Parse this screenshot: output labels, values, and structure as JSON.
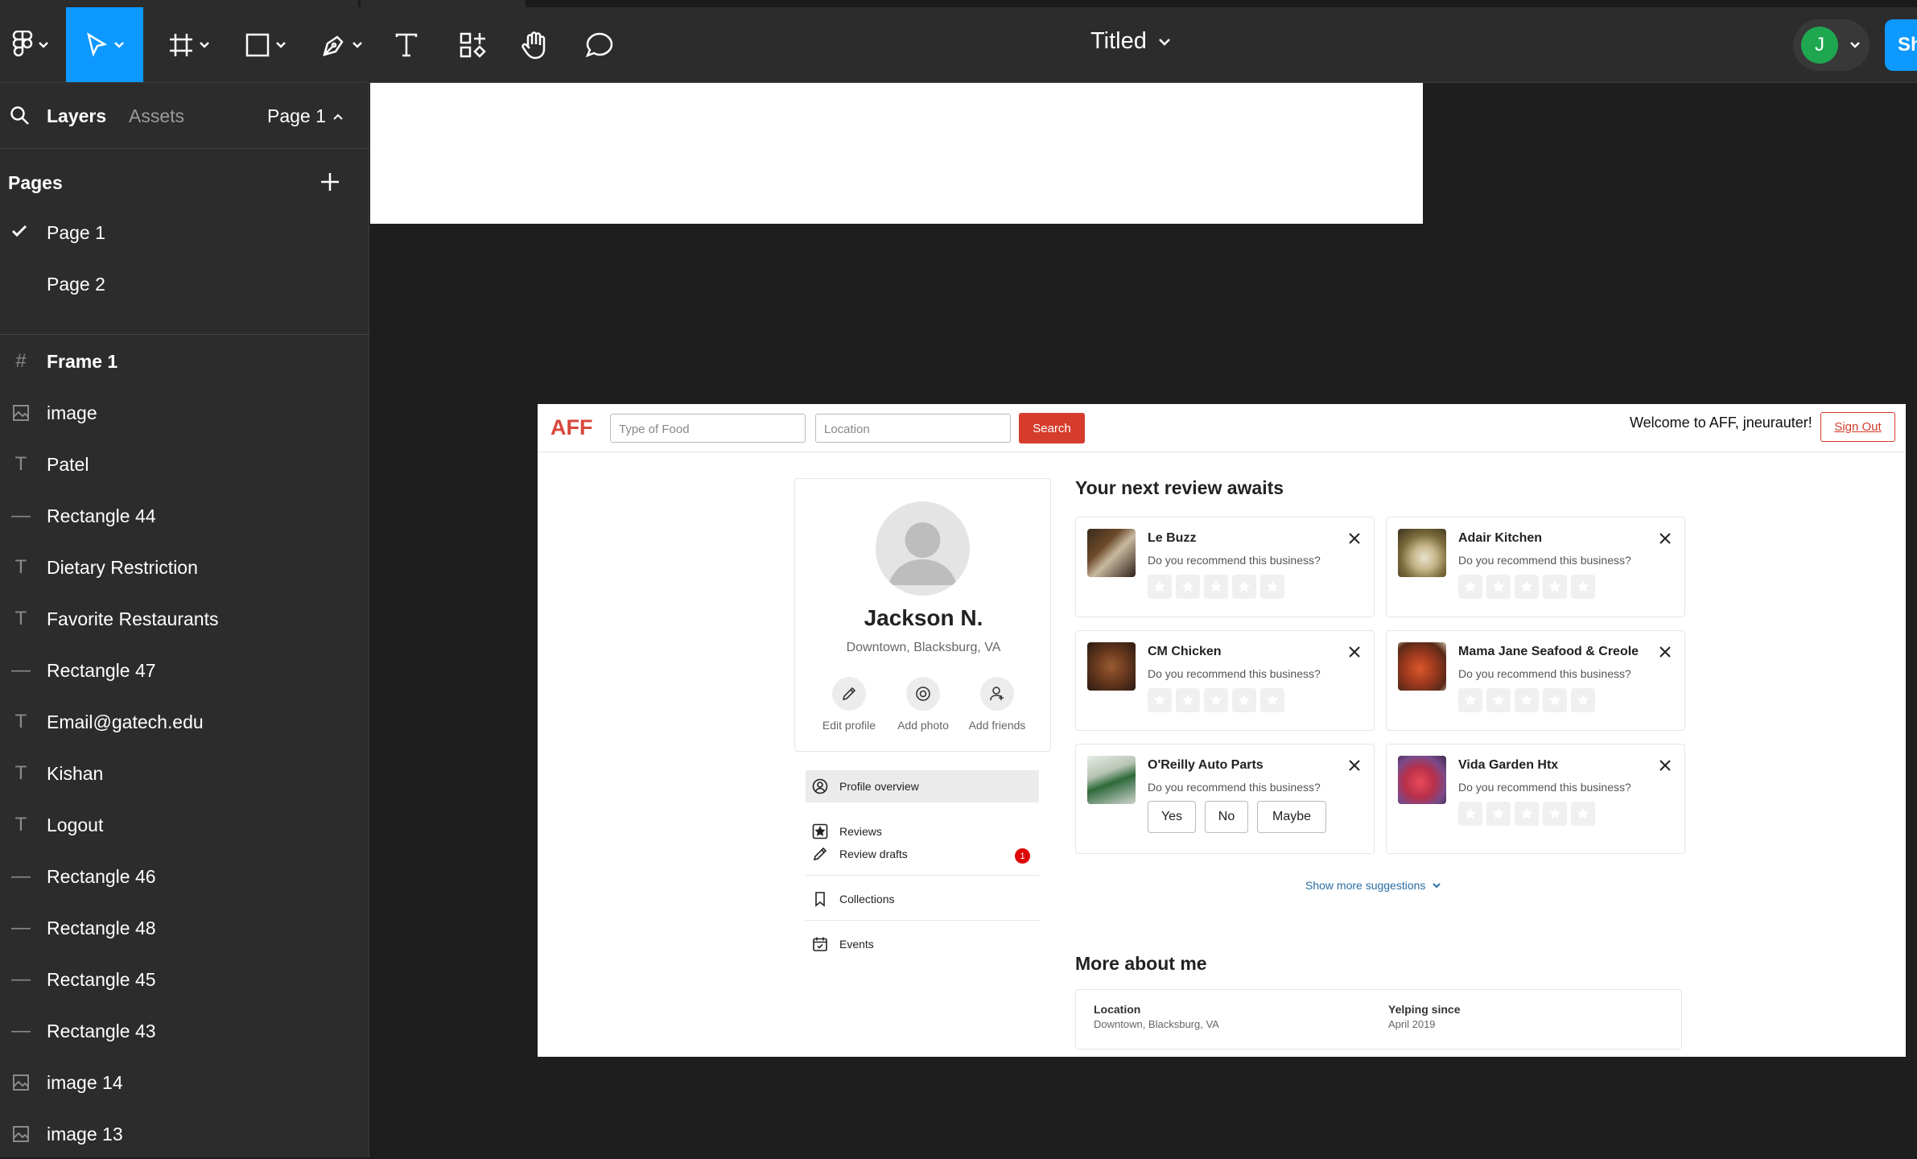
{
  "toolbar": {
    "file_title": "Titled",
    "user_initial": "J",
    "share_label": "Sh"
  },
  "panel": {
    "tab_layers": "Layers",
    "tab_assets": "Assets",
    "page_select": "Page 1",
    "pages_header": "Pages",
    "pages": [
      {
        "label": "Page 1",
        "selected": true
      },
      {
        "label": "Page 2",
        "selected": false
      }
    ],
    "layers": [
      {
        "label": "Frame 1",
        "icon": "frame-icon"
      },
      {
        "label": "image",
        "icon": "image-icon"
      },
      {
        "label": "Patel",
        "icon": "text-icon"
      },
      {
        "label": "Rectangle 44",
        "icon": "rectangle-line-icon"
      },
      {
        "label": "Dietary Restriction",
        "icon": "text-icon"
      },
      {
        "label": "Favorite Restaurants",
        "icon": "text-icon"
      },
      {
        "label": "Rectangle 47",
        "icon": "rectangle-line-icon"
      },
      {
        "label": "Email@gatech.edu",
        "icon": "text-icon"
      },
      {
        "label": "Kishan",
        "icon": "text-icon"
      },
      {
        "label": "Logout",
        "icon": "text-icon"
      },
      {
        "label": "Rectangle 46",
        "icon": "rectangle-line-icon"
      },
      {
        "label": "Rectangle 48",
        "icon": "rectangle-line-icon"
      },
      {
        "label": "Rectangle 45",
        "icon": "rectangle-line-icon"
      },
      {
        "label": "Rectangle 43",
        "icon": "rectangle-line-icon"
      },
      {
        "label": "image 14",
        "icon": "image-icon"
      },
      {
        "label": "image 13",
        "icon": "image-icon"
      }
    ]
  },
  "app": {
    "logo": "AFF",
    "food_placeholder": "Type of Food",
    "location_placeholder": "Location",
    "search_label": "Search",
    "welcome": "Welcome to AFF, jneurauter!",
    "signout": "Sign Out",
    "profile": {
      "name": "Jackson N.",
      "location": "Downtown, Blacksburg, VA",
      "actions": [
        "Edit profile",
        "Add photo",
        "Add friends"
      ]
    },
    "menu": {
      "profile_overview": "Profile overview",
      "reviews": "Reviews",
      "review_drafts": "Review drafts",
      "draft_count": "1",
      "collections": "Collections",
      "events": "Events"
    },
    "reviews_heading": "Your next review awaits",
    "question": "Do you recommend this business?",
    "review_cards": [
      {
        "name": "Le Buzz",
        "mode": "stars"
      },
      {
        "name": "Adair Kitchen",
        "mode": "stars"
      },
      {
        "name": "CM Chicken",
        "mode": "stars"
      },
      {
        "name": "Mama Jane Seafood & Creole",
        "mode": "stars"
      },
      {
        "name": "O'Reilly Auto Parts",
        "mode": "yesno"
      },
      {
        "name": "Vida Garden Htx",
        "mode": "stars"
      }
    ],
    "yes_label": "Yes",
    "no_label": "No",
    "maybe_label": "Maybe",
    "show_more": "Show more suggestions",
    "more_heading": "More about me",
    "more": {
      "location_label": "Location",
      "location_value": "Downtown, Blacksburg, VA",
      "since_label": "Yelping since",
      "since_value": "April 2019"
    }
  },
  "colors": {
    "accent": "#0d99ff",
    "brand_red": "#d63c2c",
    "avatar_green": "#1fa750"
  }
}
